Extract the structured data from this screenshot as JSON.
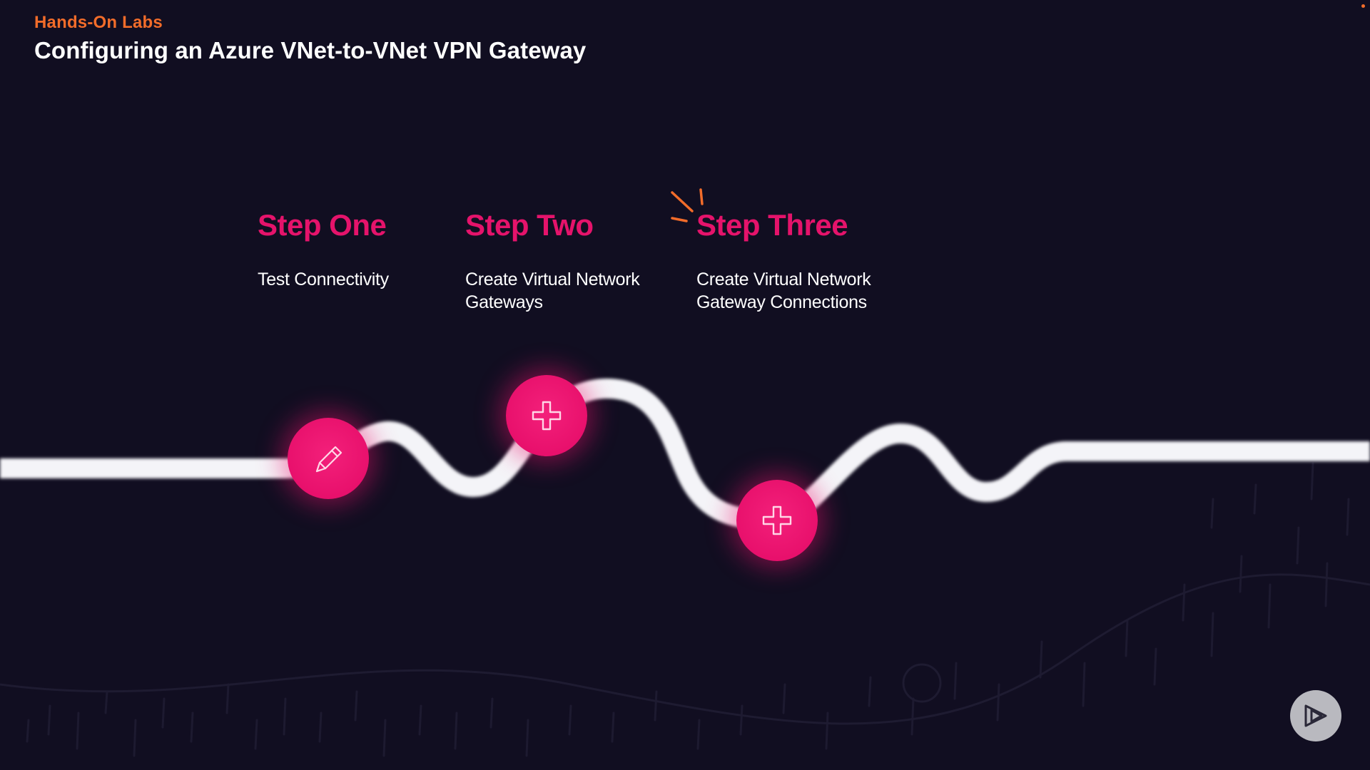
{
  "header": {
    "eyebrow": "Hands-On Labs",
    "title": "Configuring an Azure VNet-to-VNet VPN Gateway"
  },
  "steps": [
    {
      "heading": "Step One",
      "lines": [
        "Test Connectivity"
      ],
      "icon": "pencil-icon"
    },
    {
      "heading": "Step Two",
      "lines": [
        "Create Virtual Network",
        "Gateways"
      ],
      "icon": "plus-icon"
    },
    {
      "heading": "Step Three",
      "lines": [
        "Create Virtual Network",
        "Gateway Connections"
      ],
      "icon": "plus-icon"
    }
  ],
  "current_step_marker": "spark-icon",
  "player": {
    "icon": "play-logo-icon"
  },
  "colors": {
    "background": "#110e21",
    "accent_orange": "#f26c2a",
    "accent_pink": "#e5136b",
    "path": "#f4f4f8"
  }
}
